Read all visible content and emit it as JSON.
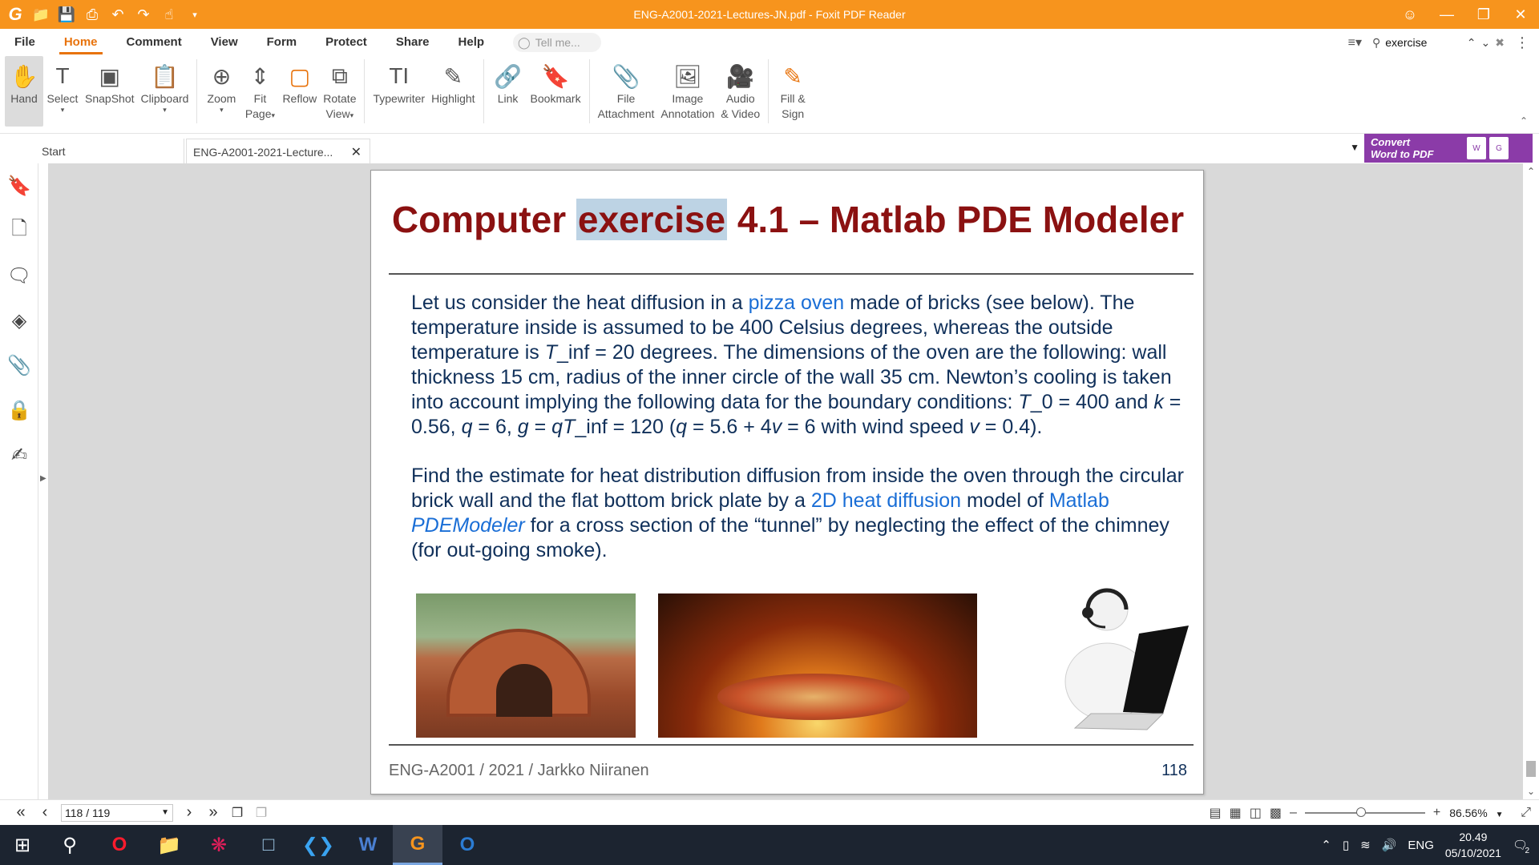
{
  "window": {
    "title": "ENG-A2001-2021-Lectures-JN.pdf - Foxit PDF Reader",
    "accent_color": "#f7941d"
  },
  "menu": {
    "items": [
      "File",
      "Home",
      "Comment",
      "View",
      "Form",
      "Protect",
      "Share",
      "Help"
    ],
    "active": "Home",
    "tell_me_placeholder": "Tell me..."
  },
  "find": {
    "query": "exercise"
  },
  "toolbar": {
    "hand": "Hand",
    "select": "Select",
    "snapshot": "SnapShot",
    "clipboard": "Clipboard",
    "zoom": "Zoom",
    "fit_page_1": "Fit",
    "fit_page_2": "Page",
    "reflow": "Reflow",
    "rotate_1": "Rotate",
    "rotate_2": "View",
    "typewriter": "Typewriter",
    "highlight": "Highlight",
    "link": "Link",
    "bookmark": "Bookmark",
    "file_attach_1": "File",
    "file_attach_2": "Attachment",
    "image_annot_1": "Image",
    "image_annot_2": "Annotation",
    "audio_1": "Audio",
    "audio_2": "& Video",
    "fill_1": "Fill &",
    "fill_2": "Sign"
  },
  "tabs": {
    "start": "Start",
    "doc": "ENG-A2001-2021-Lecture..."
  },
  "convert_banner": {
    "line1": "Convert",
    "line2": "Word to PDF"
  },
  "slide": {
    "title_pre": "Computer ",
    "title_hl": "exercise",
    "title_post": " 4.1 – Matlab PDE Modeler",
    "p1_a": "Let us consider the heat diffusion in a ",
    "p1_link": "pizza oven",
    "p1_b": " made of bricks (see below). The temperature inside is assumed to be 400 Celsius degrees, whereas the outside temperature is ",
    "p1_tinf": "T",
    "p1_c": "_inf = 20 degrees. The dimensions of the oven are the following: wall thickness 15 cm, radius of the inner circle of the wall 35 cm. Newton’s cooling is taken into account implying the following data for the boundary conditions: ",
    "p1_t0": "T",
    "p1_d": "_0 = 400 and ",
    "p1_k": "k",
    "p1_e": " = 0.56, ",
    "p1_q": "q",
    "p1_f": " = 6, ",
    "p1_g": "g",
    "p1_g2": " = ",
    "p1_qt": "qT",
    "p1_h": "_inf = 120 (",
    "p1_q2": "q",
    "p1_i": " = 5.6 + 4",
    "p1_v": "v",
    "p1_j": " = 6 with wind speed ",
    "p1_v2": "v",
    "p1_k2": " = 0.4).",
    "p2_a": "Find the estimate for heat distribution diffusion from inside the oven through the circular brick wall and the flat bottom brick plate by a ",
    "p2_link": "2D heat diffusion",
    "p2_b": " model of ",
    "p2_link2": "Matlab ",
    "p2_link2i": "PDEModeler",
    "p2_c": " for a cross section of the “tunnel” by neglecting the effect of the chimney (for out-going smoke).",
    "footer": "ENG-A2001 / 2021 / Jarkko Niiranen",
    "page_number": "118"
  },
  "status": {
    "page": "118 / 119",
    "zoom": "86.56%",
    "zoom_level": 0.43
  },
  "taskbar": {
    "lang": "ENG",
    "time": "20.49",
    "date": "05/10/2021",
    "notifications": "2"
  }
}
